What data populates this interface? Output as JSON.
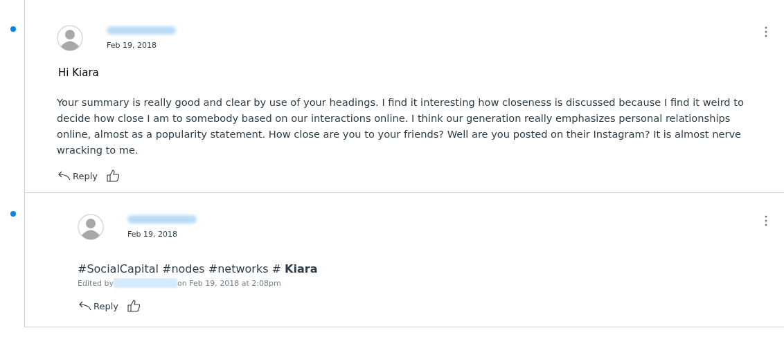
{
  "entries": [
    {
      "unread": true,
      "date": "Feb 19, 2018",
      "paragraphs": [
        "Hi Kiara",
        "Your summary is really good and clear by use of your headings. I find it interesting how closeness is discussed because I find it weird to decide how close I am to somebody based on our interactions online. I think our generation really emphasizes personal relationships online, almost as a popularity statement. How close are you to your friends? Well are you posted on their Instagram? It is almost nerve wracking to me."
      ],
      "reply_label": "Reply",
      "children": [
        {
          "unread": true,
          "date": "Feb 19, 2018",
          "paragraphs": [
            "#SocialCapital #nodes #networks # **Kiara**"
          ],
          "edited_prefix": "Edited by",
          "edited_suffix": "on Feb 19, 2018 at 2:08pm",
          "reply_label": "Reply"
        }
      ]
    }
  ]
}
